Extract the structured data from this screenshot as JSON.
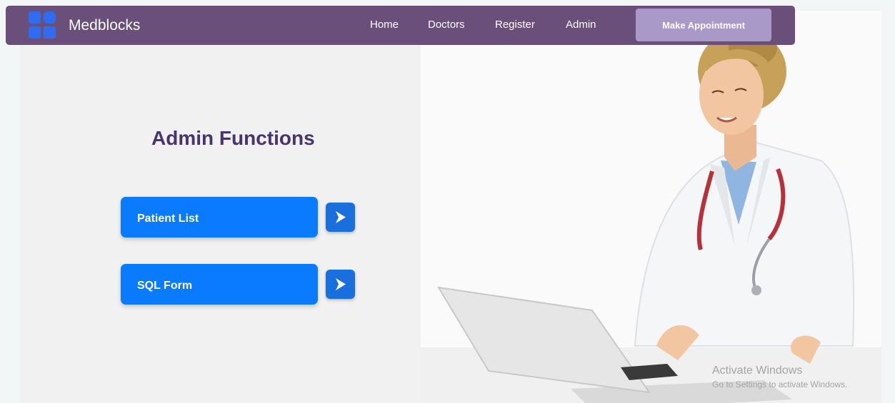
{
  "navbar": {
    "brand": "Medblocks",
    "links": [
      "Home",
      "Doctors",
      "Register",
      "Admin"
    ],
    "cta_label": "Make Appointment",
    "color": "#6b4f7b",
    "cta_color": "#a999c8"
  },
  "main": {
    "title": "Admin Functions",
    "actions": [
      {
        "label": "Patient List",
        "icon": "chevron-right-icon"
      },
      {
        "label": "SQL Form",
        "icon": "chevron-right-icon"
      }
    ],
    "accent": "#0a7bff"
  },
  "watermark": {
    "title": "Activate Windows",
    "subtitle": "Go to Settings to activate Windows."
  }
}
